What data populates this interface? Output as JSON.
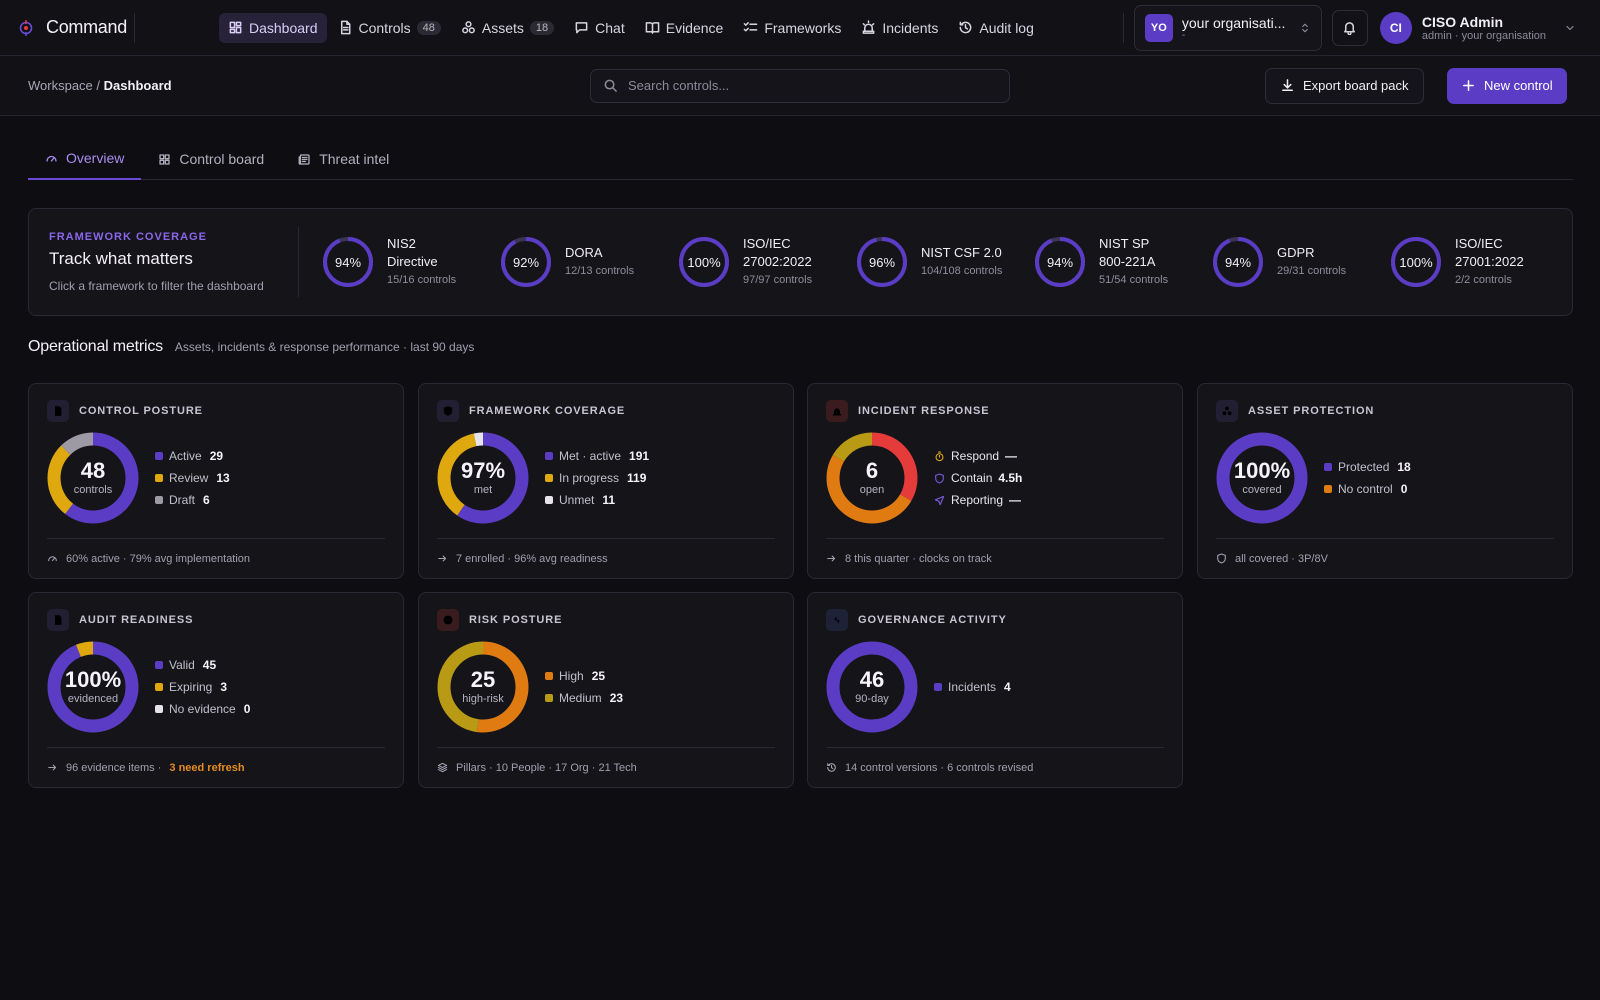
{
  "app": {
    "name": "Command"
  },
  "nav": {
    "items": [
      {
        "label": "Dashboard",
        "icon": "dashboard-icon",
        "active": true
      },
      {
        "label": "Controls",
        "icon": "document-icon",
        "count": "48"
      },
      {
        "label": "Assets",
        "icon": "assets-icon",
        "count": "18"
      },
      {
        "label": "Chat",
        "icon": "chat-icon"
      },
      {
        "label": "Evidence",
        "icon": "book-icon"
      },
      {
        "label": "Frameworks",
        "icon": "checklist-icon"
      },
      {
        "label": "Incidents",
        "icon": "siren-icon"
      },
      {
        "label": "Audit log",
        "icon": "history-icon"
      }
    ]
  },
  "org": {
    "initials": "YO",
    "name": "your organisati...",
    "sub": "-"
  },
  "user": {
    "initials": "CI",
    "name": "CISO Admin",
    "sub": "admin · your organisation"
  },
  "breadcrumb": {
    "root": "Workspace",
    "separator": "/",
    "current": "Dashboard"
  },
  "search": {
    "placeholder": "Search controls..."
  },
  "actions": {
    "export_label": "Export board pack",
    "new_label": "New control"
  },
  "tabs": [
    {
      "label": "Overview",
      "active": true
    },
    {
      "label": "Control board"
    },
    {
      "label": "Threat intel"
    }
  ],
  "framework_coverage": {
    "kicker": "FRAMEWORK COVERAGE",
    "title": "Track what matters",
    "subtitle": "Click a framework to filter the dashboard",
    "items": [
      {
        "pct_label": "94%",
        "pct": 94,
        "name_lines": [
          "NIS2",
          "Directive"
        ],
        "controls": "15/16 controls"
      },
      {
        "pct_label": "92%",
        "pct": 92,
        "name_lines": [
          "DORA"
        ],
        "controls": "12/13 controls"
      },
      {
        "pct_label": "100%",
        "pct": 100,
        "name_lines": [
          "ISO/IEC",
          "27002:2022"
        ],
        "controls": "97/97 controls"
      },
      {
        "pct_label": "96%",
        "pct": 96,
        "name_lines": [
          "NIST CSF 2.0"
        ],
        "controls": "104/108 controls"
      },
      {
        "pct_label": "94%",
        "pct": 94,
        "name_lines": [
          "NIST SP",
          "800-221A"
        ],
        "controls": "51/54 controls"
      },
      {
        "pct_label": "94%",
        "pct": 94,
        "name_lines": [
          "GDPR"
        ],
        "controls": "29/31 controls"
      },
      {
        "pct_label": "100%",
        "pct": 100,
        "name_lines": [
          "ISO/IEC",
          "27001:2022"
        ],
        "controls": "2/2 controls"
      }
    ]
  },
  "metrics": {
    "title": "Operational metrics",
    "subtitle": "Assets, incidents & response performance · last 90 days"
  },
  "colors": {
    "purple": "#5b3cc4",
    "yellow": "#e0a80f",
    "orange": "#e07b12",
    "olive": "#b89a14",
    "red": "#e53b3b",
    "gray": "#9d9aa6",
    "white": "#e6e4ea",
    "track": "#2a2832"
  },
  "cards": [
    {
      "title": "CONTROL POSTURE",
      "icon": "document-icon",
      "icon_color": "#7b5ce0",
      "icon_bg": "#231f33",
      "center_value": "48",
      "center_label": "controls",
      "segments": [
        {
          "label": "Active",
          "value": 29,
          "display": "29",
          "color": "#5b3cc4"
        },
        {
          "label": "Review",
          "value": 13,
          "display": "13",
          "color": "#e0a80f"
        },
        {
          "label": "Draft",
          "value": 6,
          "display": "6",
          "color": "#9d9aa6"
        }
      ],
      "footer_icon": "gauge-icon",
      "footer": "60% active · 79% avg implementation"
    },
    {
      "title": "FRAMEWORK COVERAGE",
      "icon": "shield-icon",
      "icon_color": "#7b5ce0",
      "icon_bg": "#231f33",
      "center_value": "97%",
      "center_label": "met",
      "segments": [
        {
          "label": "Met · active",
          "value": 191,
          "display": "191",
          "color": "#5b3cc4"
        },
        {
          "label": "In progress",
          "value": 119,
          "display": "119",
          "color": "#e0a80f"
        },
        {
          "label": "Unmet",
          "value": 11,
          "display": "11",
          "color": "#e6e4ea"
        }
      ],
      "footer_icon": "arrow-right-icon",
      "footer": "7 enrolled · 96% avg readiness"
    },
    {
      "title": "INCIDENT RESPONSE",
      "icon": "siren-icon",
      "icon_color": "#e53b3b",
      "icon_bg": "#3a1c1f",
      "center_value": "6",
      "center_label": "open",
      "segments": [
        {
          "value": 2,
          "color": "#e53b3b"
        },
        {
          "value": 3,
          "color": "#e07b12"
        },
        {
          "value": 1,
          "color": "#b89a14"
        }
      ],
      "stages": [
        {
          "label": "Respond",
          "value": "—",
          "icon": "timer-icon",
          "color": "#e0a80f"
        },
        {
          "label": "Contain",
          "value": "4.5h",
          "icon": "shield-icon",
          "color": "#7b5ce0"
        },
        {
          "label": "Reporting",
          "value": "—",
          "icon": "send-icon",
          "color": "#7b5ce0"
        }
      ],
      "footer_icon": "arrow-right-icon",
      "footer": "8 this quarter · clocks on track"
    },
    {
      "title": "ASSET PROTECTION",
      "icon": "assets-icon",
      "icon_color": "#7b5ce0",
      "icon_bg": "#231f33",
      "center_value": "100%",
      "center_label": "covered",
      "segments": [
        {
          "label": "Protected",
          "value": 18,
          "display": "18",
          "color": "#5b3cc4"
        },
        {
          "label": "No control",
          "value": 0,
          "display": "0",
          "color": "#e07b12"
        }
      ],
      "footer_icon": "shield-icon",
      "footer": "all covered · 3P/8V"
    },
    {
      "title": "AUDIT READINESS",
      "icon": "document-icon",
      "icon_color": "#7b5ce0",
      "icon_bg": "#231f33",
      "center_value": "100%",
      "center_label": "evidenced",
      "segments": [
        {
          "label": "Valid",
          "value": 45,
          "display": "45",
          "color": "#5b3cc4"
        },
        {
          "label": "Expiring",
          "value": 3,
          "display": "3",
          "color": "#e0a80f"
        },
        {
          "label": "No evidence",
          "value": 0,
          "display": "0",
          "color": "#e6e4ea"
        }
      ],
      "footer_icon": "arrow-right-icon",
      "footer": "96 evidence items ·",
      "footer_warn": "3 need refresh"
    },
    {
      "title": "RISK POSTURE",
      "icon": "alert-icon",
      "icon_color": "#e53b3b",
      "icon_bg": "#3a1c1f",
      "center_value": "25",
      "center_label": "high-risk",
      "segments": [
        {
          "label": "High",
          "value": 25,
          "display": "25",
          "color": "#e07b12"
        },
        {
          "label": "Medium",
          "value": 23,
          "display": "23",
          "color": "#b89a14"
        }
      ],
      "footer_icon": "layers-icon",
      "footer": "Pillars · 10 People · 17 Org · 21 Tech"
    },
    {
      "title": "GOVERNANCE ACTIVITY",
      "icon": "activity-icon",
      "icon_color": "#5a7ce8",
      "icon_bg": "#1d2236",
      "center_value": "46",
      "center_label": "90-day",
      "segments": [
        {
          "label": "Incidents",
          "value": 4,
          "display": "4",
          "color": "#5b3cc4"
        },
        {
          "value": 42,
          "color": "#5b3cc4"
        }
      ],
      "footer_icon": "history-icon",
      "footer": "14 control versions · 6 controls revised"
    }
  ]
}
